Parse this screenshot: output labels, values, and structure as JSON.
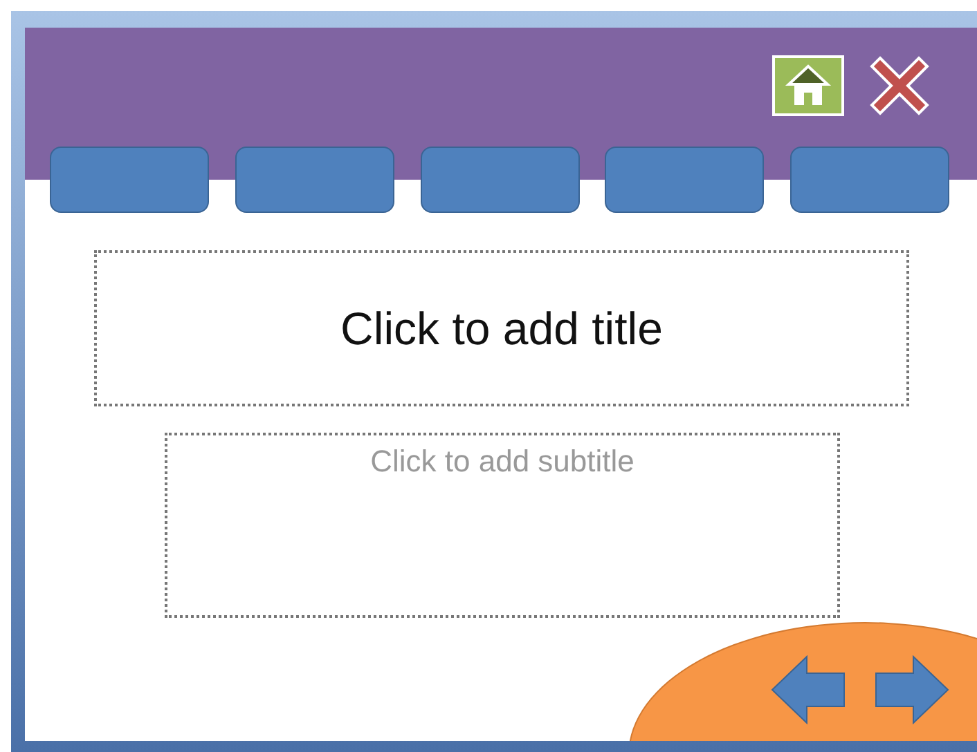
{
  "slide": {
    "title_placeholder": "Click to add title",
    "subtitle_placeholder": "Click to add subtitle"
  }
}
